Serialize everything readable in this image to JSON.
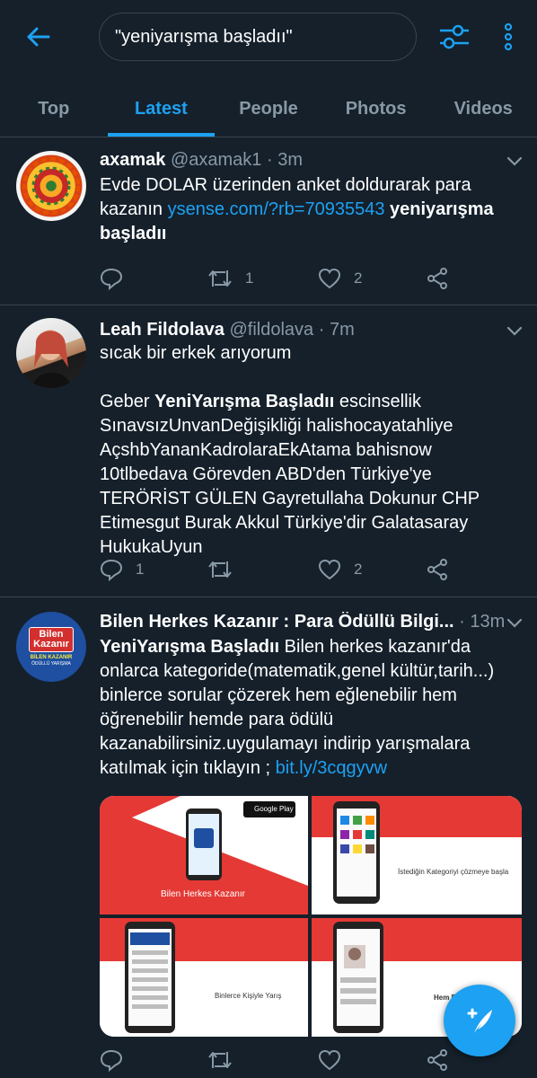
{
  "search": {
    "query": "\"yeniyarışma başladıı\""
  },
  "tabs": [
    {
      "label": "Top",
      "active": false
    },
    {
      "label": "Latest",
      "active": true
    },
    {
      "label": "People",
      "active": false
    },
    {
      "label": "Photos",
      "active": false
    },
    {
      "label": "Videos",
      "active": false
    }
  ],
  "colors": {
    "accent": "#1da1f2",
    "background": "#15202b",
    "border": "#38444d",
    "muted": "#8899a6"
  },
  "icons": [
    "back-arrow-icon",
    "filter-icon",
    "more-vertical-icon",
    "chevron-down-icon",
    "reply-icon",
    "retweet-icon",
    "like-icon",
    "share-icon",
    "compose-icon"
  ],
  "tweets": [
    {
      "name": "axamak",
      "meta": "@axamak1 · 3m",
      "text_plain": "Evde DOLAR üzerinden anket doldurarak para kazanın ",
      "link": "ysense.com/?rb=70935543",
      "bold_tail": " yeniyarışma başladıı",
      "replies": "",
      "retweets": "1",
      "likes": "2"
    },
    {
      "name": "Leah Fildolava",
      "meta": "@fildolava · 7m",
      "line1": "sıcak bir erkek arıyorum",
      "p2_start": "Geber ",
      "p2_bold": "YeniYarışma Başladıı",
      "p2_rest": " escinsellik SınavsızUnvanDeğişikliği halishocayatahliye AçshbYananKadrolaraEkAtama bahisnow 10tlbedava Görevden ABD'den Türkiye'ye TERÖRİST GÜLEN Gayretullaha Dokunur CHP Etimesgut Burak Akkul Türkiye'dir Galatasaray HukukaUyun",
      "replies": "1",
      "retweets": "",
      "likes": "2"
    },
    {
      "name": "Bilen Herkes Kazanır : Para Ödüllü Bilgi...",
      "meta": " · 13m",
      "bold_start": "YeniYarışma Başladıı",
      "text": " Bilen herkes kazanır'da onlarca kategoride(matematik,genel kültür,tarih...) binlerce sorular çözerek hem eğlenebilir hem öğrenebilir hemde para ödülü kazanabilirsiniz.uygulamayı indirip yarışmalara katılmak için tıklayın ; ",
      "link": "bit.ly/3cqgyvw",
      "avatar_text1": "Bilen",
      "avatar_text2": "Kazanır",
      "avatar_text3": "BİLEN KAZANIR",
      "avatar_text4": "ÖDÜLLÜ YARIŞMA",
      "media": {
        "cell1_caption": "Bilen Herkes Kazanır",
        "cell1_badge": "Google Play",
        "cell2_caption": "İstediğin Kategoriyi çözmeye başla",
        "cell3_caption": "Binlerce Kişiyle Yarış",
        "cell4_caption": "Hem Eğ"
      }
    }
  ]
}
